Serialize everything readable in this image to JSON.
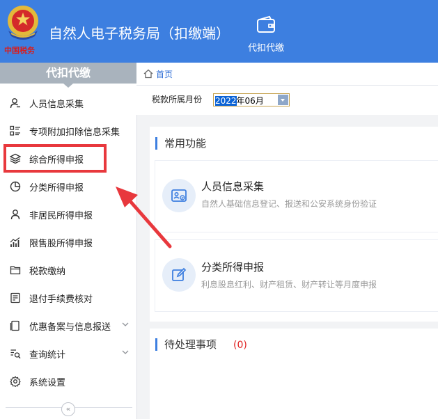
{
  "header": {
    "emblem_text": "中国税务",
    "app_title": "自然人电子税务局（扣缴端）",
    "top_tab_label": "代扣代缴",
    "bg_color": "#3d7fe0"
  },
  "sidebar": {
    "title": "代扣代缴",
    "items": [
      {
        "label": "人员信息采集",
        "icon": "person-icon"
      },
      {
        "label": "专项附加扣除信息采集",
        "icon": "list-icon"
      },
      {
        "label": "综合所得申报",
        "icon": "layers-icon"
      },
      {
        "label": "分类所得申报",
        "icon": "pie-chart-icon"
      },
      {
        "label": "非居民所得申报",
        "icon": "user-outline-icon"
      },
      {
        "label": "限售股所得申报",
        "icon": "bar-chart-icon"
      },
      {
        "label": "税款缴纳",
        "icon": "folder-icon"
      },
      {
        "label": "退付手续费核对",
        "icon": "checklist-icon"
      },
      {
        "label": "优惠备案与信息报送",
        "icon": "document-icon",
        "has_submenu": true
      },
      {
        "label": "查询统计",
        "icon": "search-list-icon",
        "has_submenu": true
      },
      {
        "label": "系统设置",
        "icon": "gear-icon"
      }
    ],
    "collapse_symbol": "«"
  },
  "breadcrumb": {
    "home_label": "首页"
  },
  "filter": {
    "label": "税款所属月份",
    "month_year": "2022",
    "month_rest": "年06月"
  },
  "common_functions": {
    "title": "常用功能",
    "cards": [
      {
        "title": "人员信息采集",
        "desc": "自然人基础信息登记、报送和公安系统身份验证",
        "icon": "id-card-icon"
      },
      {
        "title": "分类所得申报",
        "desc": "利息股息红利、财产租赁、财产转让等月度申报",
        "icon": "edit-icon"
      }
    ]
  },
  "pending": {
    "title": "待处理事项",
    "count": "(0)"
  },
  "colors": {
    "accent": "#3d7fe0",
    "annotation": "#e8383d",
    "pending_count": "#e02020"
  }
}
